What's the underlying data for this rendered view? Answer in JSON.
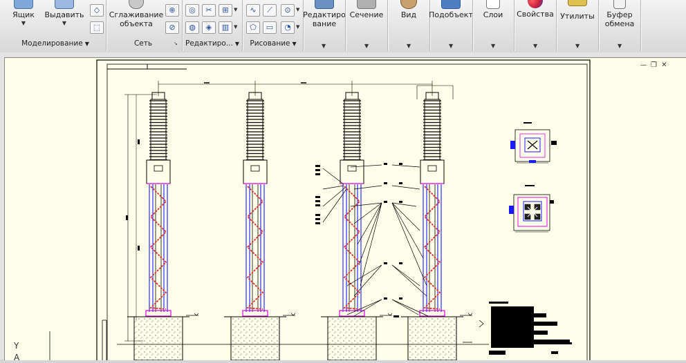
{
  "ribbon": {
    "buttons": {
      "box": "Ящик",
      "extrude": "Выдавить",
      "smooth": "Сглаживание\nобъекта",
      "edit": "Редактиро\nвание",
      "section": "Сечение",
      "view": "Вид",
      "subobject": "Подобъект",
      "layers": "Слои",
      "properties": "Свойства",
      "utilities": "Утилиты",
      "clipboard": "Буфер\nобмена"
    },
    "groups": {
      "modeling": "Моделирование",
      "mesh": "Сеть",
      "editing": "Редактиро...",
      "drawing": "Рисование"
    },
    "dropdown_glyph": "▼",
    "launcher_glyph": "↘"
  },
  "window_controls": {
    "minimize": "—",
    "restore": "❐",
    "close": "✕"
  },
  "ucs": {
    "y_label": "Y",
    "a_label": "A"
  },
  "colors": {
    "viewport_bg": "#ffffe9",
    "line_black": "#000000",
    "line_blue": "#1a1aff",
    "line_magenta": "#e000e0",
    "line_red": "#e03030",
    "accent_props": "#c81e3c"
  }
}
